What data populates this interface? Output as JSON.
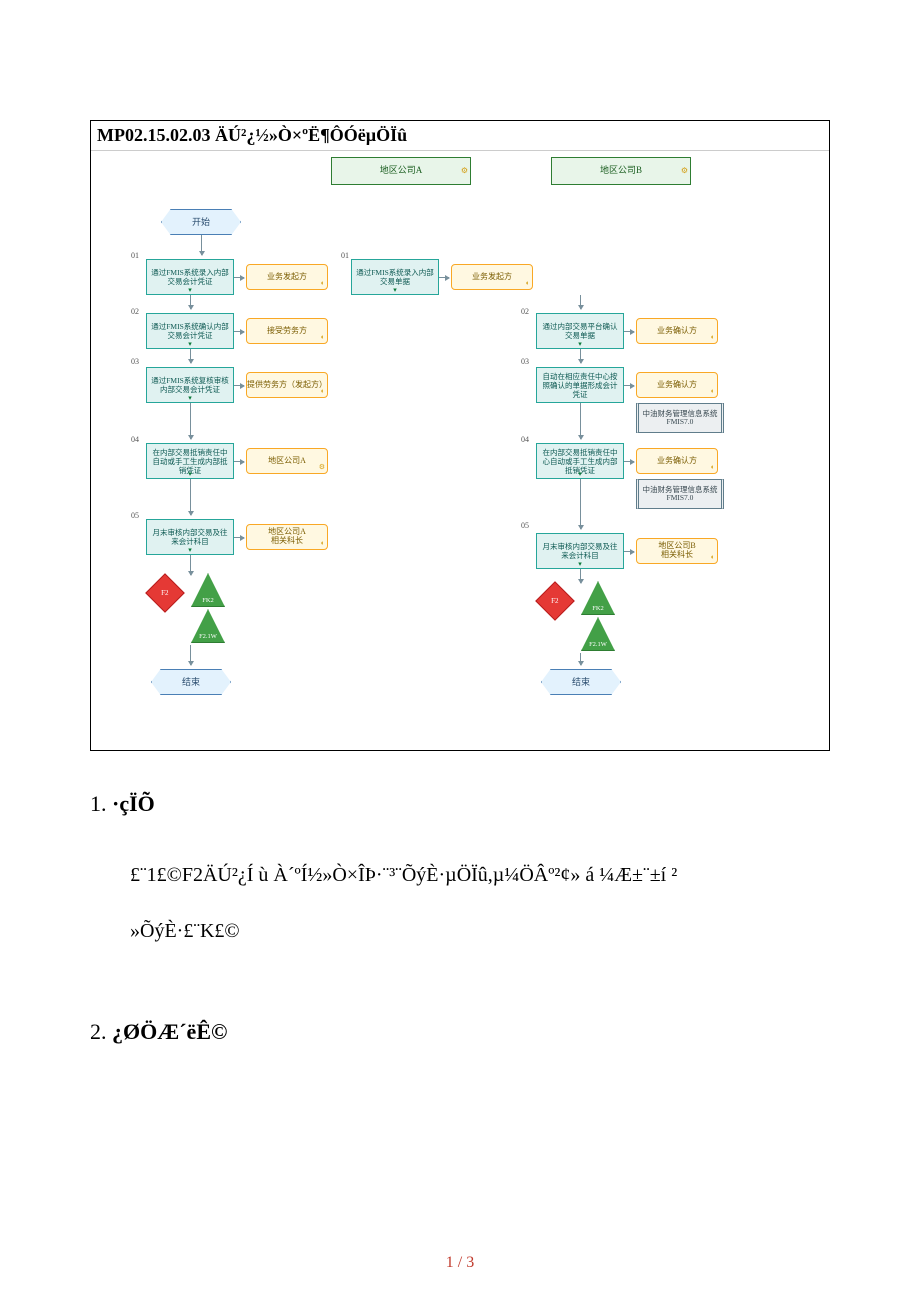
{
  "diagram": {
    "title": "MP02.15.02.03 ÄÚ²¿½»Ò×ºË¶ÔÓëµÖÏû",
    "lane_a": "地区公司A",
    "lane_b": "地区公司B",
    "start": "开始",
    "end_a": "结束",
    "end_b": "结束",
    "left": {
      "n01": "01",
      "t01a": "通过FMIS系统录入内部交易会计凭证",
      "r01a": "业务发起方",
      "n01b": "01",
      "t01b": "通过FMIS系统录入内部交易单据",
      "r01b": "业务发起方",
      "n02": "02",
      "t02": "通过FMIS系统确认内部交易会计凭证",
      "r02": "接受劳务方",
      "n03": "03",
      "t03": "通过FMIS系统复核审核内部交易会计凭证",
      "r03": "提供劳务方（发起方）",
      "n04": "04",
      "t04": "在内部交易抵销责任中自动或手工生成内部抵销凭证",
      "r04": "地区公司A",
      "n05": "05",
      "t05": "月末审核内部交易及往来会计科目",
      "r05": "地区公司A\n相关科长"
    },
    "right": {
      "n02": "02",
      "t02": "通过内部交易平台确认交易单据",
      "r02": "业务确认方",
      "n03": "03",
      "t03": "自动在相应责任中心按照确认的单据形成会计凭证",
      "r03": "业务确认方",
      "s03": "中油财务管理信息系统\nFMIS7.0",
      "n04": "04",
      "t04": "在内部交易抵销责任中心自动或手工生成内部抵销凭证",
      "r04": "业务确认方",
      "s04": "中油财务管理信息系统\nFMIS7.0",
      "n05": "05",
      "t05": "月末审核内部交易及往来会计科目",
      "r05": "地区公司B\n相关科长"
    },
    "risk": {
      "f2_l": "F2",
      "fk2_l": "FK2",
      "f21w_l": "F2.1W",
      "f2_r": "F2",
      "fk2_r": "FK2",
      "f21w_r": "F2.1W"
    }
  },
  "sections": {
    "s1_num": "1.",
    "s1_title": "·çÏÕ",
    "s1_body_line1": "£¨1£©F2ÄÚ²¿Í ù À´ºÍ½»Ò×ÎÞ·¨³¨ÕýÈ·µÖÏû,µ¼ÖÂº²¢» á ¼Æ±¨±í ²",
    "s1_body_line2": "»ÕýÈ·£¨K£©",
    "s2_num": "2.",
    "s2_title": "¿ØÖÆ´ëÊ©"
  },
  "page_number": "1 / 3"
}
